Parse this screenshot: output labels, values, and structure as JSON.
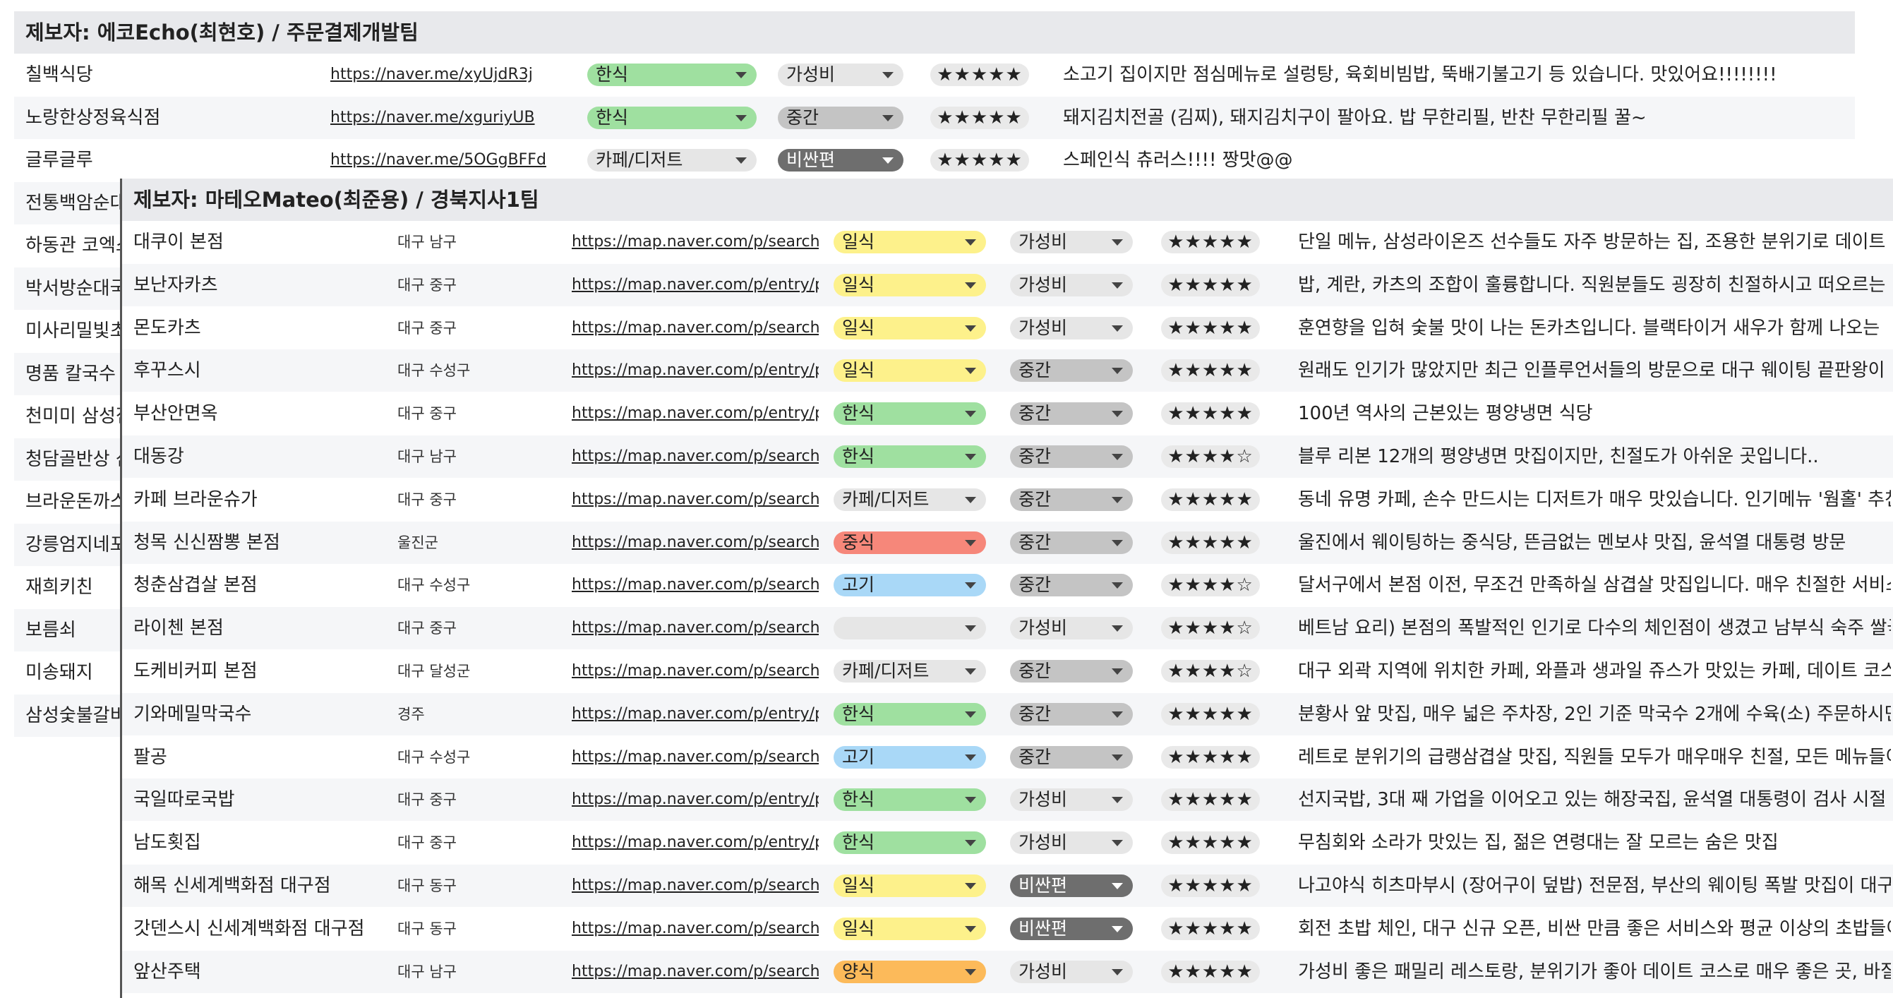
{
  "colors": {
    "korean": "#9fe0a0",
    "japanese": "#fdf18b",
    "chinese": "#f6877a",
    "meat": "#a9d8f7",
    "western": "#fcba5a",
    "cafe": "#e6e6e6",
    "empty": "#e6e6e6",
    "value": "#e6e6e6",
    "mid": "#c4c4c4",
    "expensive": "#6e6e6e"
  },
  "sheet_back": {
    "header": "제보자: 에코Echo(최현호) / 주문결제개발팀",
    "rows": [
      {
        "name": "칠백식당",
        "url": "https://naver.me/xyUjdR3j",
        "category": "한식",
        "cat_color": "korean",
        "price": "가성비",
        "price_color": "value",
        "rating": "★★★★★",
        "desc": "소고기 집이지만 점심메뉴로 설렁탕, 육회비빔밥, 뚝배기불고기 등 있습니다. 맛있어요!!!!!!!!"
      },
      {
        "name": "노랑한상정육식점",
        "url": "https://naver.me/xguriyUB",
        "category": "한식",
        "cat_color": "korean",
        "price": "중간",
        "price_color": "mid",
        "rating": "★★★★★",
        "desc": "돼지김치전골 (김찌), 돼지김치구이 팔아요. 밥 무한리필, 반찬 무한리필 꿀~"
      },
      {
        "name": "글루글루",
        "url": "https://naver.me/5OGgBFFd",
        "category": "카페/디저트",
        "cat_color": "cafe",
        "price": "비싼편",
        "price_color": "expensive",
        "rating": "★★★★★",
        "desc": "스페인식 츄러스!!!! 짱맛@@"
      },
      {
        "name": "전통백암순대"
      },
      {
        "name": "하동관 코엑스점"
      },
      {
        "name": "박서방순대국"
      },
      {
        "name": "미사리밀빛초계국수"
      },
      {
        "name": "명품 칼국수"
      },
      {
        "name": "천미미 삼성점"
      },
      {
        "name": "청담골반상 삼성점"
      },
      {
        "name": "브라운돈까스"
      },
      {
        "name": "강릉엄지네포장마차"
      },
      {
        "name": "재희키친"
      },
      {
        "name": "보름쇠"
      },
      {
        "name": "미송돼지"
      },
      {
        "name": "삼성숯불갈비"
      }
    ]
  },
  "sheet_front": {
    "header": "제보자: 마테오Mateo(최준용) / 경북지사1팀",
    "rows": [
      {
        "name": "대쿠이 본점",
        "region": "대구 남구",
        "url": "https://map.naver.com/p/search/%",
        "category": "일식",
        "cat_color": "japanese",
        "price": "가성비",
        "price_color": "value",
        "rating": "★★★★★",
        "desc": "단일 메뉴, 삼성라이온즈 선수들도 자주 방문하는 집, 조용한 분위기로 데이트"
      },
      {
        "name": "보난자카츠",
        "region": "대구 중구",
        "url": "https://map.naver.com/p/entry/pla",
        "category": "일식",
        "cat_color": "japanese",
        "price": "가성비",
        "price_color": "value",
        "rating": "★★★★★",
        "desc": "밥, 계란, 카츠의 조합이 훌륭합니다. 직원분들도 굉장히 친절하시고 떠오르는"
      },
      {
        "name": "몬도카츠",
        "region": "대구 중구",
        "url": "https://map.naver.com/p/search/%",
        "category": "일식",
        "cat_color": "japanese",
        "price": "가성비",
        "price_color": "value",
        "rating": "★★★★★",
        "desc": "훈연향을 입혀 숯불 맛이 나는 돈카츠입니다. 블랙타이거 새우가 함께 나오는"
      },
      {
        "name": "후꾸스시",
        "region": "대구 수성구",
        "url": "https://map.naver.com/p/entry/pla",
        "category": "일식",
        "cat_color": "japanese",
        "price": "중간",
        "price_color": "mid",
        "rating": "★★★★★",
        "desc": "원래도 인기가 많았지만 최근 인플루언서들의 방문으로 대구 웨이팅 끝판왕이"
      },
      {
        "name": "부산안면옥",
        "region": "대구 중구",
        "url": "https://map.naver.com/p/entry/pla",
        "category": "한식",
        "cat_color": "korean",
        "price": "중간",
        "price_color": "mid",
        "rating": "★★★★★",
        "desc": "100년 역사의 근본있는 평양냉면 식당"
      },
      {
        "name": "대동강",
        "region": "대구 남구",
        "url": "https://map.naver.com/p/search/%",
        "category": "한식",
        "cat_color": "korean",
        "price": "중간",
        "price_color": "mid",
        "rating": "★★★★☆",
        "desc": "블루 리본 12개의 평양냉면 맛집이지만, 친절도가 아쉬운 곳입니다.."
      },
      {
        "name": "카페 브라운슈가",
        "region": "대구 중구",
        "url": "https://map.naver.com/p/search/%",
        "category": "카페/디저트",
        "cat_color": "cafe",
        "price": "중간",
        "price_color": "mid",
        "rating": "★★★★★",
        "desc": "동네 유명 카페, 손수 만드시는 디저트가 매우 맛있습니다. 인기메뉴 '웜홀' 추천"
      },
      {
        "name": "청목 신신짬뽕 본점",
        "region": "울진군",
        "url": "https://map.naver.com/p/search/%",
        "category": "중식",
        "cat_color": "chinese",
        "price": "중간",
        "price_color": "mid",
        "rating": "★★★★★",
        "desc": "울진에서 웨이팅하는 중식당, 뜬금없는 멘보샤 맛집, 윤석열 대통령 방문"
      },
      {
        "name": "청춘삼겹살 본점",
        "region": "대구 수성구",
        "url": "https://map.naver.com/p/search/%",
        "category": "고기",
        "cat_color": "meat",
        "price": "중간",
        "price_color": "mid",
        "rating": "★★★★☆",
        "desc": "달서구에서 본점 이전, 무조건 만족하실 삼겹살 맛집입니다. 매우 친절한 서비스"
      },
      {
        "name": "라이첸 본점",
        "region": "대구 중구",
        "url": "https://map.naver.com/p/search/%",
        "category": "",
        "cat_color": "empty",
        "price": "가성비",
        "price_color": "value",
        "rating": "★★★★☆",
        "desc": "베트남 요리) 본점의 폭발적인 인기로 다수의 체인점이 생겼고 남부식 숙주 쌀국수"
      },
      {
        "name": "도케비커피 본점",
        "region": "대구 달성군",
        "url": "https://map.naver.com/p/search/%",
        "category": "카페/디저트",
        "cat_color": "cafe",
        "price": "중간",
        "price_color": "mid",
        "rating": "★★★★☆",
        "desc": "대구 외곽 지역에 위치한 카페, 와플과 생과일 쥬스가 맛있는 카페, 데이트 코스"
      },
      {
        "name": "기와메밀막국수",
        "region": "경주",
        "url": "https://map.naver.com/p/entry/pla",
        "category": "한식",
        "cat_color": "korean",
        "price": "중간",
        "price_color": "mid",
        "rating": "★★★★★",
        "desc": "분황사 앞 맛집, 매우 넓은 주차장, 2인 기준 막국수 2개에 수육(소) 주문하시면"
      },
      {
        "name": "팔공",
        "region": "대구 수성구",
        "url": "https://map.naver.com/p/search/%",
        "category": "고기",
        "cat_color": "meat",
        "price": "중간",
        "price_color": "mid",
        "rating": "★★★★★",
        "desc": "레트로 분위기의 급랭삼겹살 맛집, 직원들 모두가 매우매우 친절, 모든 메뉴들이"
      },
      {
        "name": "국일따로국밥",
        "region": "대구 중구",
        "url": "https://map.naver.com/p/entry/pla",
        "category": "한식",
        "cat_color": "korean",
        "price": "가성비",
        "price_color": "value",
        "rating": "★★★★★",
        "desc": "선지국밥, 3대 째 가업을 이어오고 있는 해장국집, 윤석열 대통령이 검사 시절"
      },
      {
        "name": "남도횟집",
        "region": "대구 중구",
        "url": "https://map.naver.com/p/entry/pla",
        "category": "한식",
        "cat_color": "korean",
        "price": "가성비",
        "price_color": "value",
        "rating": "★★★★★",
        "desc": "무침회와 소라가 맛있는 집, 젊은 연령대는 잘 모르는 숨은 맛집"
      },
      {
        "name": "해목 신세계백화점 대구점",
        "region": "대구 동구",
        "url": "https://map.naver.com/p/search/%",
        "category": "일식",
        "cat_color": "japanese",
        "price": "비싼편",
        "price_color": "expensive",
        "rating": "★★★★★",
        "desc": "나고야식 히츠마부시 (장어구이 덮밥) 전문점, 부산의 웨이팅 폭발 맛집이 대구"
      },
      {
        "name": "갓덴스시 신세계백화점 대구점",
        "region": "대구 동구",
        "url": "https://map.naver.com/p/search/%",
        "category": "일식",
        "cat_color": "japanese",
        "price": "비싼편",
        "price_color": "expensive",
        "rating": "★★★★★",
        "desc": "회전 초밥 체인, 대구 신규 오픈, 비싼 만큼 좋은 서비스와 평균 이상의 초밥들이"
      },
      {
        "name": "앞산주택",
        "region": "대구 남구",
        "url": "https://map.naver.com/p/search/%",
        "category": "양식",
        "cat_color": "western",
        "price": "가성비",
        "price_color": "value",
        "rating": "★★★★★",
        "desc": "가성비 좋은 패밀리 레스토랑, 분위기가 좋아 데이트 코스로 매우 좋은 곳, 바질"
      }
    ]
  }
}
